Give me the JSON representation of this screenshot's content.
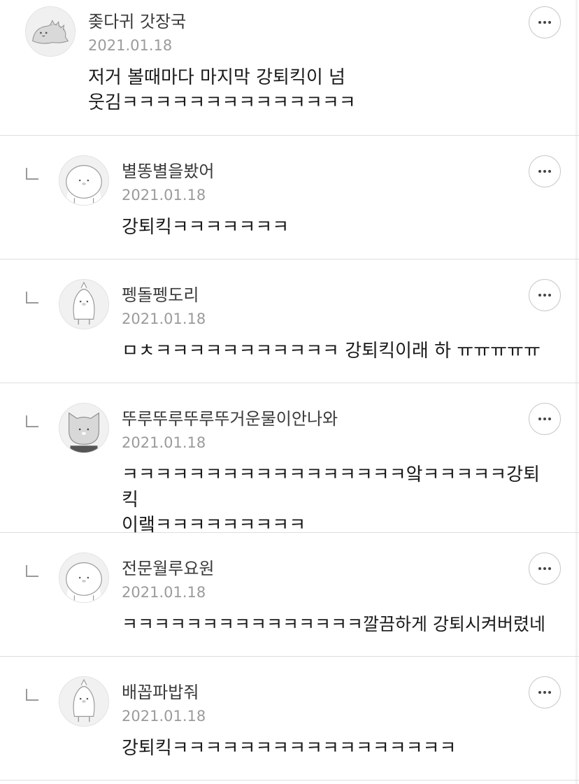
{
  "comments": [
    {
      "nickname": "좆다귀 갓장국",
      "date": "2021.01.18",
      "text": "저거 볼때마다 마지막 강퇴킥이 넘\n웃김ㅋㅋㅋㅋㅋㅋㅋㅋㅋㅋㅋㅋㅋㅋ",
      "avatar_icon": "dinosaur-avatar-icon",
      "is_reply": false
    },
    {
      "nickname": "별똥별을봤어",
      "date": "2021.01.18",
      "text": "강퇴킥ㅋㅋㅋㅋㅋㅋㅋ",
      "avatar_icon": "bear-avatar-icon",
      "is_reply": true
    },
    {
      "nickname": "펭돌펭도리",
      "date": "2021.01.18",
      "text": "ㅁㅊㅋㅋㅋㅋㅋㅋㅋㅋㅋㅋㅋ 강퇴킥이래 하 ㅠㅠㅠㅠㅠ",
      "avatar_icon": "penguin-avatar-icon",
      "is_reply": true
    },
    {
      "nickname": "뚜루뚜루뚜루뚜거운물이안나와",
      "date": "2021.01.18",
      "text": "ㅋㅋㅋㅋㅋㅋㅋㅋㅋㅋㅋㅋㅋㅋㅋㅋㅋ앜ㅋㅋㅋㅋㅋ강퇴킥\n이랰ㅋㅋㅋㅋㅋㅋㅋㅋㅋ",
      "avatar_icon": "cat-avatar-icon",
      "is_reply": true
    },
    {
      "nickname": "전문월루요원",
      "date": "2021.01.18",
      "text": "ㅋㅋㅋㅋㅋㅋㅋㅋㅋㅋㅋㅋㅋㅋㅋ깔끔하게 강퇴시켜버렸네",
      "avatar_icon": "bear-avatar-icon",
      "is_reply": true
    },
    {
      "nickname": "배꼽파밥줘",
      "date": "2021.01.18",
      "text": "강퇴킥ㅋㅋㅋㅋㅋㅋㅋㅋㅋㅋㅋㅋㅋㅋㅋㅋㅋ",
      "avatar_icon": "penguin-avatar-icon",
      "is_reply": true
    }
  ]
}
